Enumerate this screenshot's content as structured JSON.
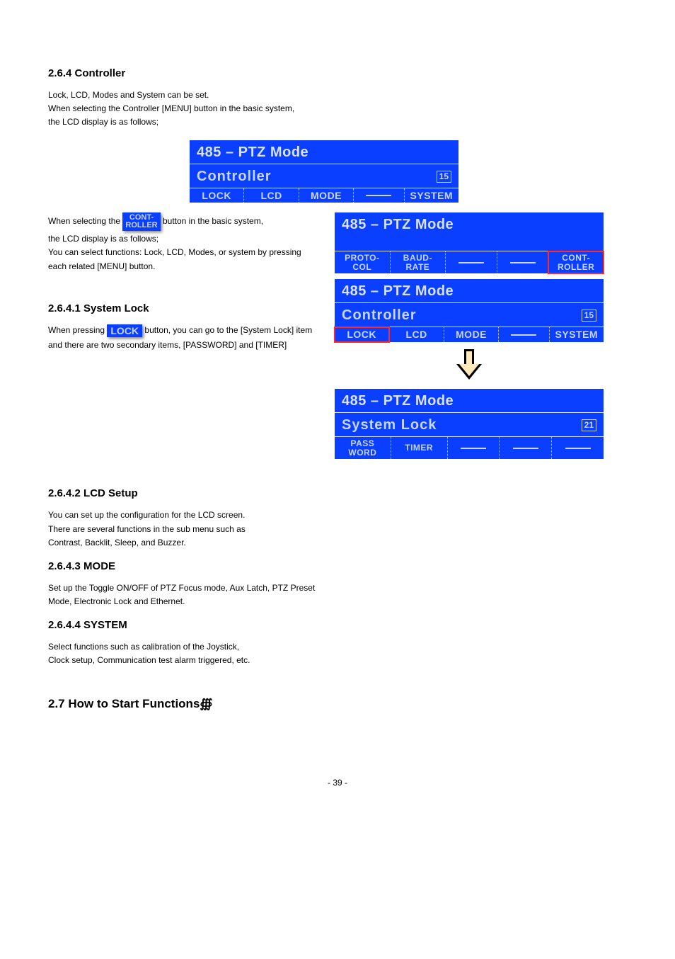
{
  "headings": {
    "top_label": "2.6.4 Controller",
    "section_lock": "2.6.4.1 System Lock",
    "section_lcd": "2.6.4.2 LCD Setup",
    "section_mode": "2.6.4.3 MODE",
    "section_system": "2.6.4.4 SYSTEM",
    "section_hsf": "2.7 How to Start Functions∰"
  },
  "blurbs": {
    "s264_1": "Lock, LCD, Modes and System can be set.",
    "s264_2": "When selecting the Controller [MENU] button in the basic system,",
    "s264_3": "the LCD display is as follows;",
    "s264_4": "When selecting the ",
    "s264_4b": " button in the basic system,",
    "s264_5": "the LCD display is as follows;",
    "s264_6": "You can select functions: Lock, LCD, Modes, or system by pressing",
    "s264_7": "each related [MENU] button.",
    "s2641_1": "When pressing ",
    "s2641_1b": " button, you can go to the [System Lock] item",
    "s2641_2": "and there are two secondary items, [PASSWORD] and [TIMER]",
    "s2642_1": "You can set up the configuration for the LCD screen.",
    "s2642_2": "There are several functions in the sub menu such as",
    "s2642_3": "Contrast, Backlit, Sleep, and Buzzer.",
    "s2643_1": "Set up the Toggle ON/OFF of PTZ Focus mode, Aux Latch, PTZ Preset",
    "s2643_2": "Mode, Electronic Lock and Ethernet.",
    "s2644_1": "Select functions such as calibration of the Joystick,",
    "s2644_2": "Clock setup, Communication test alarm triggered, etc."
  },
  "chip": {
    "controller_l1": "CONT-",
    "controller_l2": "ROLLER",
    "lock": "LOCK"
  },
  "osd1": {
    "title": "485 – PTZ Mode",
    "sub": "Controller",
    "page": "15",
    "opts": [
      "LOCK",
      "LCD",
      "MODE",
      "",
      "SYSTEM"
    ]
  },
  "osd2": {
    "title": "485 – PTZ Mode",
    "opts_l1": [
      "PROTO-",
      "BAUD-",
      "",
      "",
      "CONT-"
    ],
    "opts_l2": [
      "COL",
      "RATE",
      "",
      "",
      "ROLLER"
    ]
  },
  "osd3": {
    "title": "485 – PTZ Mode",
    "sub": "Controller",
    "page": "15",
    "opts": [
      "LOCK",
      "LCD",
      "MODE",
      "",
      "SYSTEM"
    ]
  },
  "osd4": {
    "title": "485 – PTZ Mode",
    "sub": "System Lock",
    "page": "21",
    "opts_l1": [
      "PASS",
      "TIMER",
      "",
      "",
      ""
    ],
    "opts_l2": [
      "WORD",
      "",
      "",
      "",
      ""
    ]
  },
  "footer": "- 39 -"
}
